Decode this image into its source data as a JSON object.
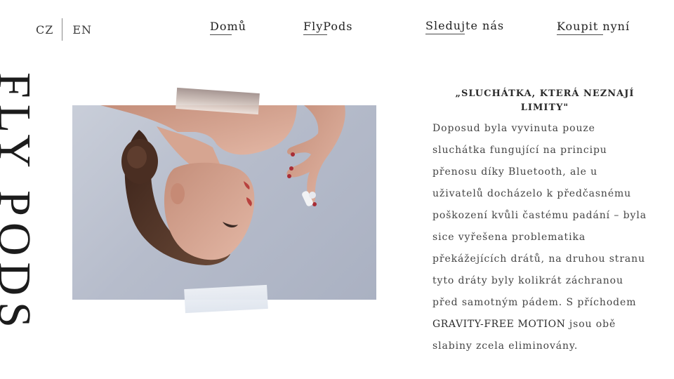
{
  "language_switch": {
    "cz": "CZ",
    "en": "EN",
    "active": "CZ"
  },
  "nav": {
    "home": "Domů",
    "product": "FlyPods",
    "follow": "Sledujte nás",
    "buy": "Koupit nyní"
  },
  "brand": {
    "vertical_title": "FLY PODS"
  },
  "hero_image": {
    "subject": "woman upside down holding earbud",
    "colors": {
      "background": "#b9bfcd",
      "skin": "#d7a592",
      "hair": "#4a3024",
      "lips": "#b8413e"
    }
  },
  "article": {
    "quote": "„SLUCHÁTKA, KTERÁ NEZNAJÍ LIMITY\"",
    "paragraph_before": "Doposud byla vyvinuta pouze sluchátka fungující na principu přenosu díky Bluetooth, ale u uživatelů docházelo k předčasnému poškození kvůli častému padání – byla sice vyřešena problematika překážejících drátů, na druhou stranu tyto dráty byly kolikrát záchranou před samotným pádem. S příchodem ",
    "highlight": "GRAVITY-FREE MOTION",
    "paragraph_after": " jsou obě slabiny zcela eliminovány."
  }
}
